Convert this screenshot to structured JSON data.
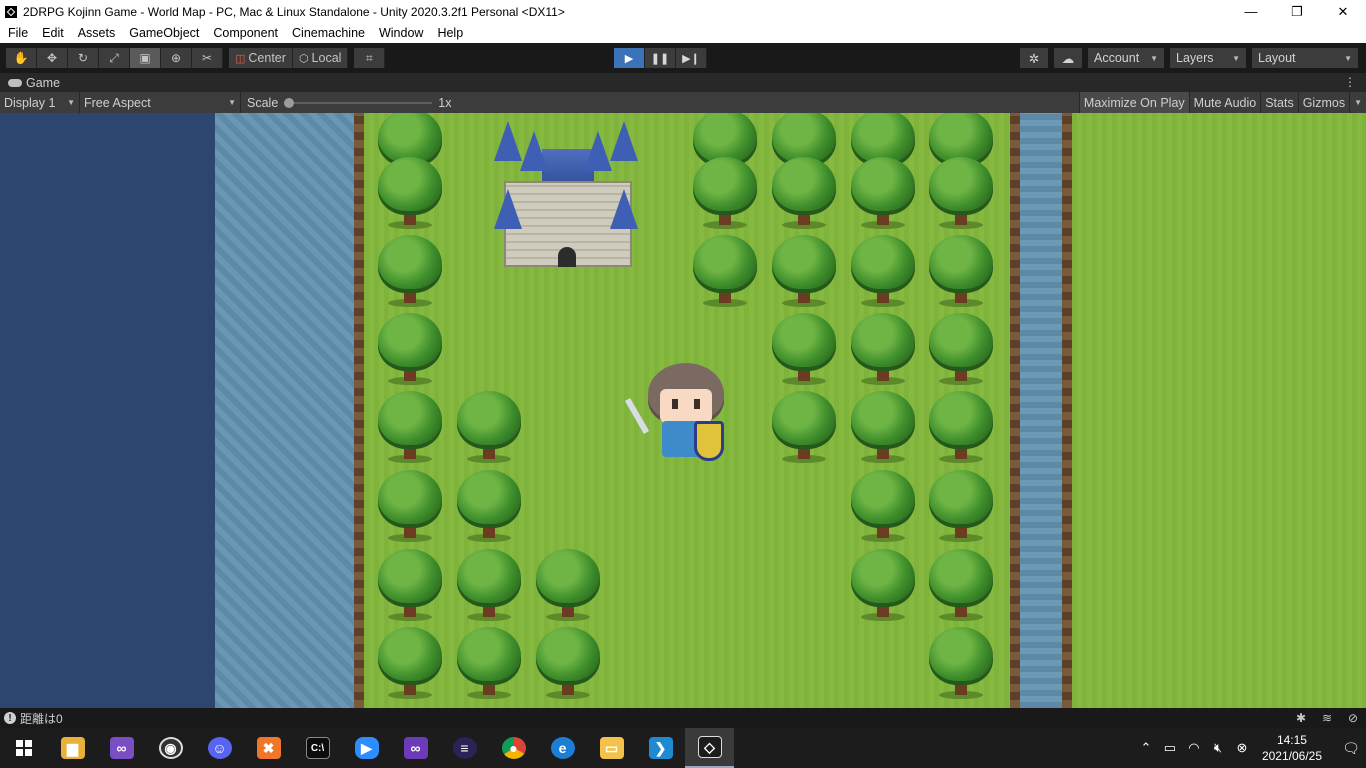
{
  "window": {
    "title": "2DRPG Kojinn Game - World Map - PC, Mac & Linux Standalone - Unity 2020.3.2f1 Personal <DX11>",
    "minimize": "—",
    "maximize": "❐",
    "close": "✕"
  },
  "menu": [
    "File",
    "Edit",
    "Assets",
    "GameObject",
    "Component",
    "Cinemachine",
    "Window",
    "Help"
  ],
  "toolbar": {
    "tools": [
      "hand-tool",
      "move-tool",
      "rotate-tool",
      "scale-tool",
      "rect-tool",
      "transform-tool",
      "custom-tool"
    ],
    "active_tool": "rect-tool",
    "pivot_label": "Center",
    "space_label": "Local",
    "account_label": "Account",
    "layers_label": "Layers",
    "layout_label": "Layout"
  },
  "playmode": {
    "playing": true
  },
  "game_tab": {
    "label": "Game"
  },
  "game_bar": {
    "display": "Display 1",
    "aspect": "Free Aspect",
    "scale_label": "Scale",
    "scale_value": "1x",
    "maximize": "Maximize On Play",
    "mute": "Mute Audio",
    "stats": "Stats",
    "gizmos": "Gizmos"
  },
  "status": {
    "message": "距離は0"
  },
  "taskbar": {
    "apps": [
      "file-explorer",
      "visual-studio",
      "obs",
      "discord",
      "xampp",
      "terminal",
      "zoom",
      "visual-studio-2",
      "eclipse",
      "chrome",
      "internet-explorer",
      "folder",
      "vscode",
      "unity"
    ],
    "active_app": "unity",
    "time": "14:15",
    "date": "2021/06/25"
  },
  "colors": {
    "play_active": "#3c73b8",
    "grass": "#7fb33c",
    "ocean": "#2d4670",
    "river": "#6a97b4"
  }
}
